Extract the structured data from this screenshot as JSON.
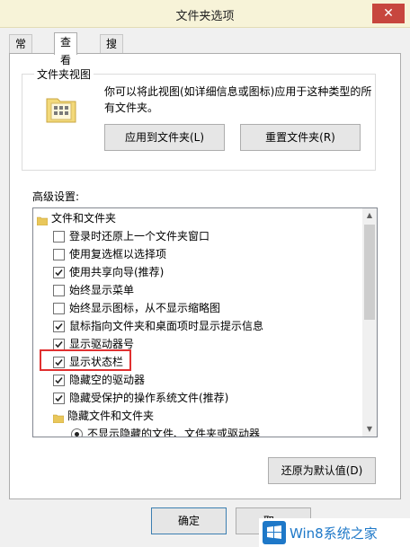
{
  "window": {
    "title": "文件夹选项",
    "close_glyph": "✕"
  },
  "tabs": [
    {
      "label": "常规",
      "active": false
    },
    {
      "label": "查看",
      "active": true
    },
    {
      "label": "搜索",
      "active": false
    }
  ],
  "folder_view": {
    "group_title": "文件夹视图",
    "description": "你可以将此视图(如详细信息或图标)应用于这种类型的所有文件夹。",
    "apply_button": "应用到文件夹(L)",
    "reset_button": "重置文件夹(R)"
  },
  "advanced": {
    "label": "高级设置:",
    "items": [
      {
        "kind": "folder",
        "label": "文件和文件夹"
      },
      {
        "kind": "checkbox",
        "label": "登录时还原上一个文件夹窗口",
        "checked": false
      },
      {
        "kind": "checkbox",
        "label": "使用复选框以选择项",
        "checked": false
      },
      {
        "kind": "checkbox",
        "label": "使用共享向导(推荐)",
        "checked": true
      },
      {
        "kind": "checkbox",
        "label": "始终显示菜单",
        "checked": false
      },
      {
        "kind": "checkbox",
        "label": "始终显示图标，从不显示缩略图",
        "checked": false
      },
      {
        "kind": "checkbox",
        "label": "鼠标指向文件夹和桌面项时显示提示信息",
        "checked": true
      },
      {
        "kind": "checkbox",
        "label": "显示驱动器号",
        "checked": true
      },
      {
        "kind": "checkbox",
        "label": "显示状态栏",
        "checked": true
      },
      {
        "kind": "checkbox",
        "label": "隐藏空的驱动器",
        "checked": true
      },
      {
        "kind": "checkbox",
        "label": "隐藏受保护的操作系统文件(推荐)",
        "checked": true
      },
      {
        "kind": "folder",
        "label": "隐藏文件和文件夹"
      },
      {
        "kind": "radio",
        "label": "不显示隐藏的文件、文件夹或驱动器",
        "checked": true
      }
    ]
  },
  "restore_button": "还原为默认值(D)",
  "footer": {
    "ok_button": "确定",
    "cancel_button": "取"
  },
  "watermark": {
    "text": "Win8系统之家"
  },
  "colors": {
    "title_bar": "#f7f3d8",
    "close": "#c7463e",
    "highlight_box": "#e03030",
    "watermark_text": "#1e78c8"
  }
}
